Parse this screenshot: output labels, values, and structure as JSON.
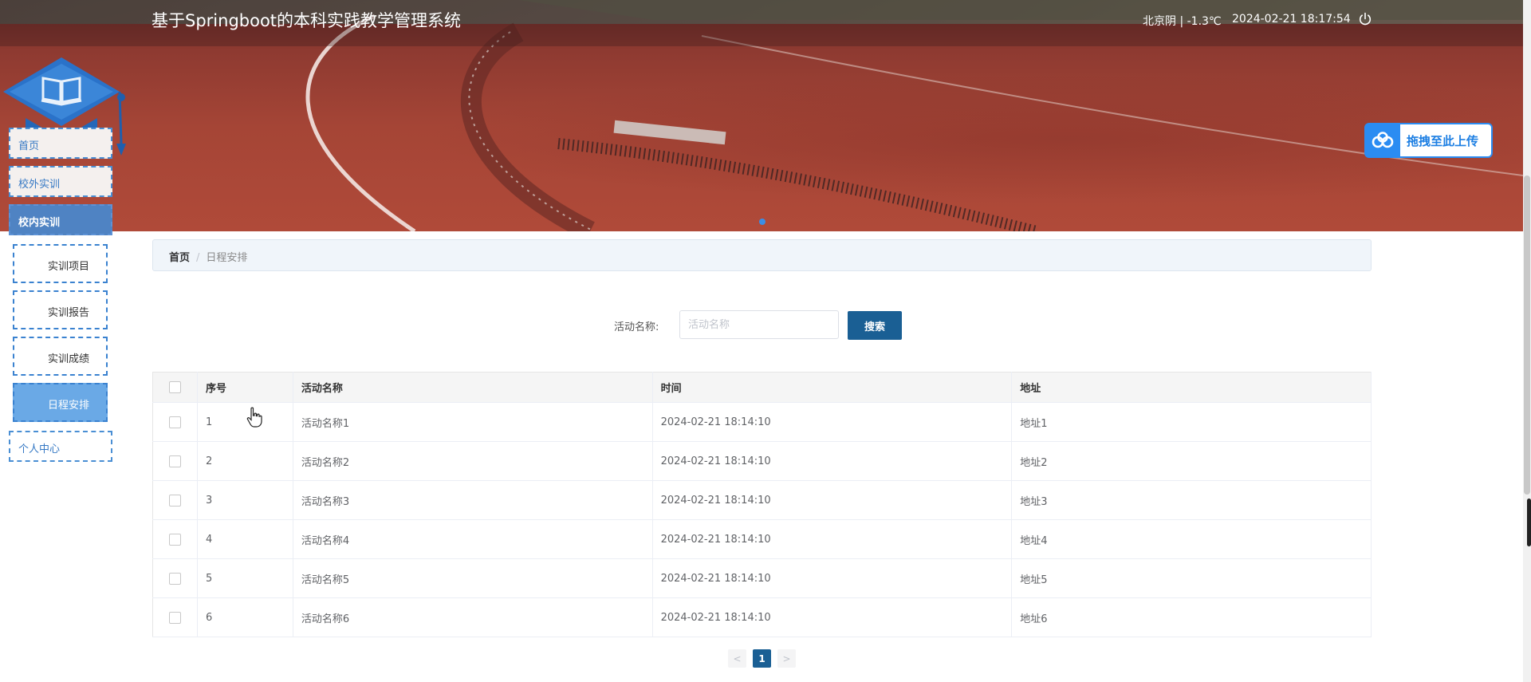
{
  "header": {
    "title": "基于Springboot的本科实践教学管理系统",
    "weather": "北京阴 | -1.3℃",
    "datetime": "2024-02-21  18:17:54",
    "logout_icon": "power-icon"
  },
  "upload_widget": {
    "label": "拖拽至此上传",
    "icon": "baidu-cloud-icon"
  },
  "sidebar": {
    "items": [
      {
        "label": "首页"
      },
      {
        "label": "校外实训"
      },
      {
        "label": "校内实训",
        "active": true
      },
      {
        "label": "实训项目"
      },
      {
        "label": "实训报告"
      },
      {
        "label": "实训成绩"
      },
      {
        "label": "日程安排",
        "active": true
      },
      {
        "label": "个人中心"
      }
    ]
  },
  "breadcrumb": {
    "home": "首页",
    "separator": "/",
    "current": "日程安排"
  },
  "search": {
    "label": "活动名称:",
    "placeholder": "活动名称",
    "button": "搜索"
  },
  "table": {
    "headers": [
      "序号",
      "活动名称",
      "时间",
      "地址"
    ],
    "rows": [
      [
        "1",
        "活动名称1",
        "2024-02-21 18:14:10",
        "地址1"
      ],
      [
        "2",
        "活动名称2",
        "2024-02-21 18:14:10",
        "地址2"
      ],
      [
        "3",
        "活动名称3",
        "2024-02-21 18:14:10",
        "地址3"
      ],
      [
        "4",
        "活动名称4",
        "2024-02-21 18:14:10",
        "地址4"
      ],
      [
        "5",
        "活动名称5",
        "2024-02-21 18:14:10",
        "地址5"
      ],
      [
        "6",
        "活动名称6",
        "2024-02-21 18:14:10",
        "地址6"
      ]
    ]
  },
  "pagination": {
    "prev": "<",
    "current_page": "1",
    "next": ">"
  },
  "colors": {
    "accent": "#1a5f94",
    "nav_border": "#3a82d0",
    "nav_active": "#6aa9e6",
    "banner_track": "#a54536"
  }
}
